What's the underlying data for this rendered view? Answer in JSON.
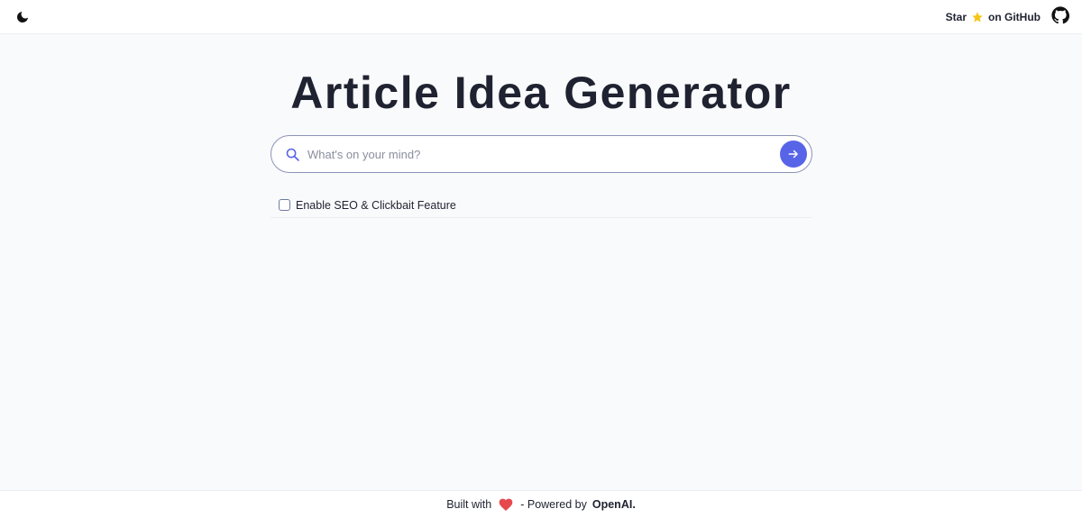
{
  "header": {
    "github_star_text": "Star",
    "github_suffix_text": "on GitHub",
    "icons": {
      "theme_toggle": "moon-icon",
      "star": "star-icon",
      "github": "github-icon"
    }
  },
  "main": {
    "title": "Article Idea Generator",
    "search": {
      "placeholder": "What's on your mind?",
      "value": ""
    },
    "seo_checkbox": {
      "label": "Enable SEO & Clickbait Feature",
      "checked": false
    }
  },
  "footer": {
    "built_with": "Built with",
    "powered_by": "- Powered by",
    "brand": "OpenAI."
  },
  "colors": {
    "accent": "#5864e8",
    "heart": "#e5484d",
    "star": "#f5c518"
  }
}
